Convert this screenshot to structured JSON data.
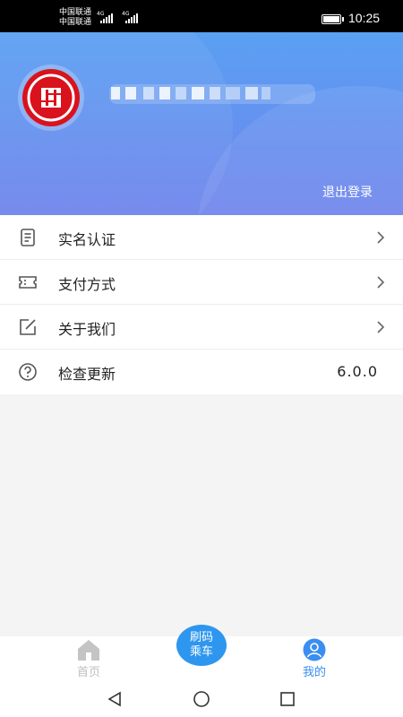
{
  "status_bar": {
    "carrier_1": "中国联通",
    "carrier_2": "中国联通",
    "network_1": "4G",
    "network_2": "4G",
    "time": "10:25"
  },
  "profile": {
    "logout_label": "退出登录"
  },
  "menu": {
    "items": [
      {
        "label": "实名认证",
        "icon": "document-icon"
      },
      {
        "label": "支付方式",
        "icon": "ticket-icon"
      },
      {
        "label": "关于我们",
        "icon": "edit-icon"
      },
      {
        "label": "检查更新",
        "icon": "help-circle-icon",
        "value": "6.0.0"
      }
    ]
  },
  "tabbar": {
    "home_label": "首页",
    "scan_label_line1": "刷码",
    "scan_label_line2": "乘车",
    "mine_label": "我的"
  },
  "colors": {
    "header_top": "#5aa0f3",
    "header_bottom": "#6f84ec",
    "accent": "#2e96ee",
    "active_tab": "#3a8ef0",
    "logo_red": "#d9121d"
  }
}
